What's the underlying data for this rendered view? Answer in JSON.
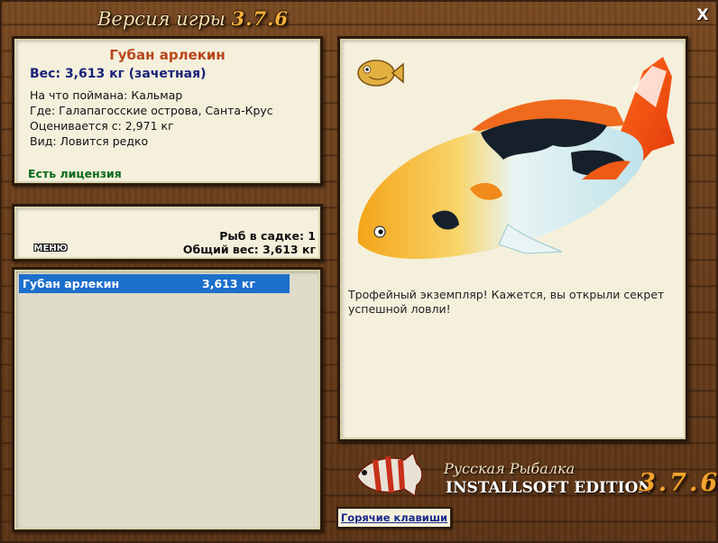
{
  "window": {
    "title_prefix": "Версия игры",
    "title_version": "3.7.6",
    "close_glyph": "X"
  },
  "info": {
    "fish_name": "Губан арлекин",
    "weight_line": "Вес: 3,613 кг (зачетная)",
    "caught_on": "На что поймана: Кальмар",
    "location": "Где: Галапагосские острова, Санта-Крус",
    "valued_from": "Оценивается с: 2,971 кг",
    "kind": "Вид: Ловится редко",
    "license": "Есть лицензия"
  },
  "cage": {
    "menu_label": "МЕНЮ",
    "fish_count": "Рыб в садке: 1",
    "total_weight": "Общий вес: 3,613 кг"
  },
  "list": {
    "items": [
      {
        "name": "Губан арлекин",
        "weight": "3,613 кг"
      }
    ]
  },
  "photo": {
    "trophy_text": "Трофейный экземпляр! Кажется, вы открыли секрет успешной ловли!"
  },
  "logo": {
    "line1": "Русская Рыбалка",
    "line2": "INSTALLSOFT EDITION",
    "version": "3.7.6"
  },
  "hotkeys_label": "Горячие клавиши",
  "colors": {
    "fish_name": "#b8461a",
    "weight": "#1a237a",
    "license": "#0b6a1a",
    "selection": "#1c6fcb",
    "version_orange": "#f3a42c"
  }
}
